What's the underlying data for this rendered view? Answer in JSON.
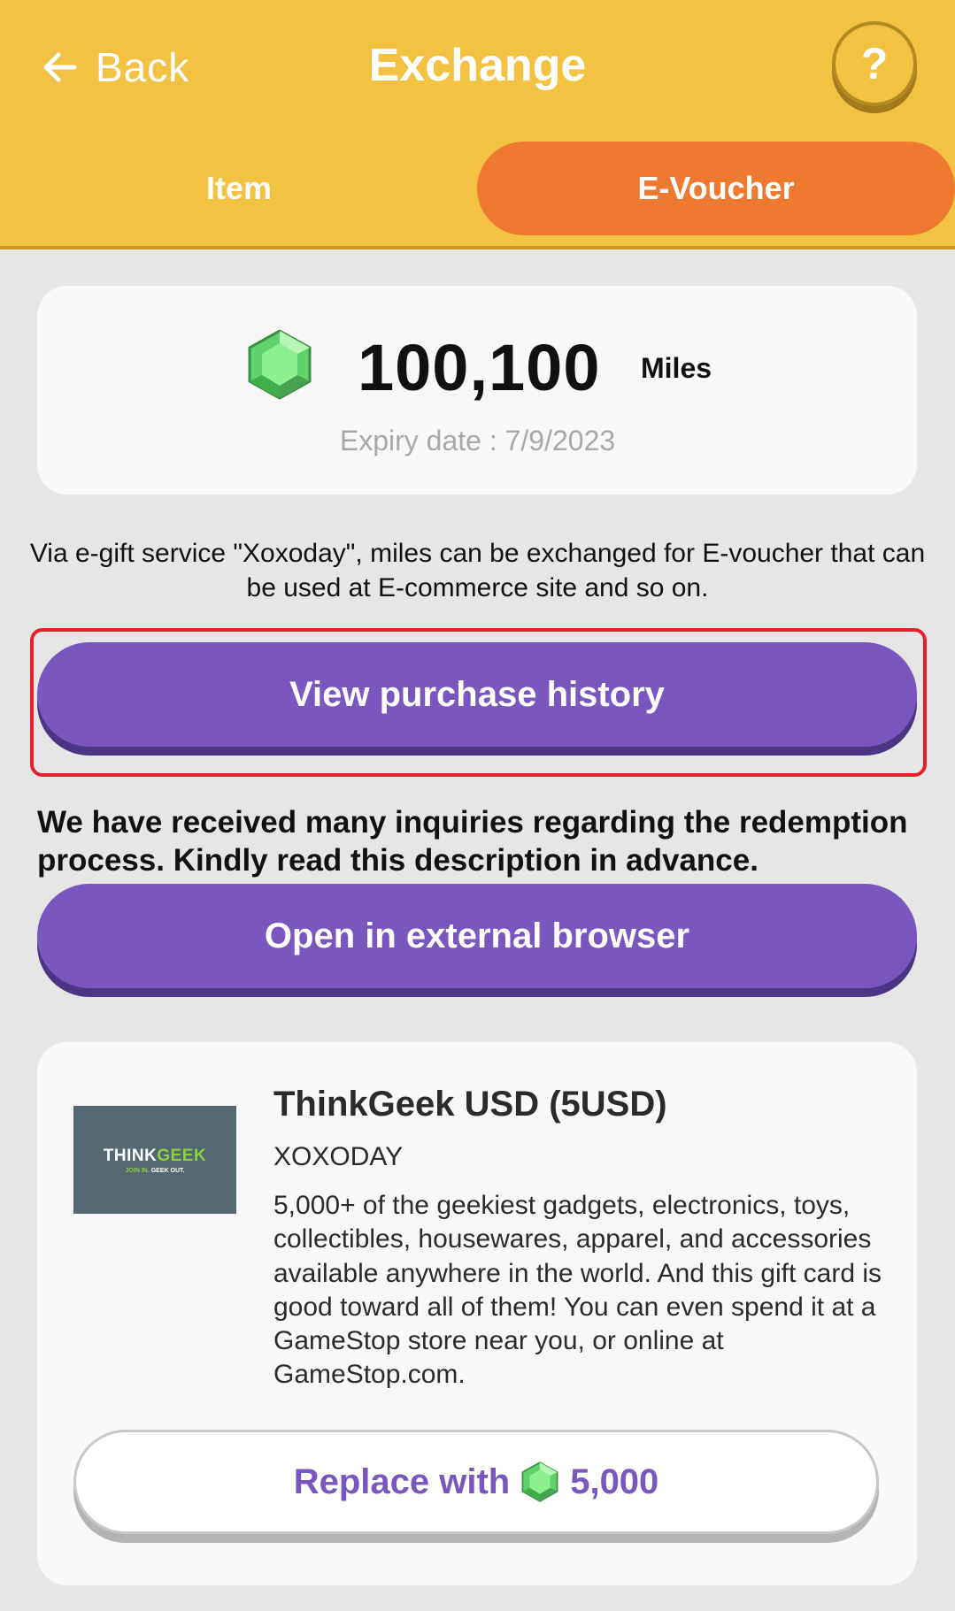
{
  "header": {
    "back_label": "Back",
    "title": "Exchange",
    "help_label": "?"
  },
  "tabs": [
    {
      "label": "Item",
      "active": false
    },
    {
      "label": "E-Voucher",
      "active": true
    }
  ],
  "balance": {
    "value": "100,100",
    "unit": "Miles",
    "expiry": "Expiry date : 7/9/2023"
  },
  "description_lines": [
    "Via e-gift service \"Xoxoday\", miles can be exchanged for E-voucher that can",
    "be used at E-commerce site and so on."
  ],
  "buttons": {
    "purchase_history": "View purchase history",
    "external_browser": "Open in external browser"
  },
  "notice": " We have received many inquiries regarding the redemption process. Kindly read this description in advance.",
  "product": {
    "logo": {
      "text_main": "THINK",
      "text_accent": "GEEK",
      "tagline_a": "JOIN IN.",
      "tagline_b": " GEEK OUT."
    },
    "title": "ThinkGeek USD (5USD)",
    "vendor": "XOXODAY",
    "description": "5,000+ of the geekiest gadgets, electronics, toys, collectibles, housewares, apparel, and accessories available anywhere in the world. And this gift card is good toward all of them! You can even spend it at a GameStop store near you, or online at GameStop.com.",
    "replace_label": "Replace with",
    "price": "5,000"
  },
  "colors": {
    "header_bg": "#f3c243",
    "active_tab": "#ee7a31",
    "primary_button": "#7a56bf",
    "highlight_border": "#e3202b",
    "gem": "#5fd36a"
  },
  "icons": [
    "back-arrow-icon",
    "help-icon",
    "gem-icon"
  ]
}
